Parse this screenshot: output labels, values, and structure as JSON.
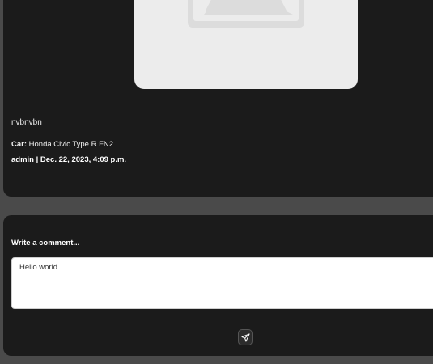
{
  "post": {
    "title": "nvbnvbn",
    "car_label": "Car:",
    "car_value": "Honda Civic Type R FN2",
    "meta": "admin | Dec. 22, 2023, 4:09 p.m.",
    "image_placeholder_icon": "image-placeholder-icon"
  },
  "comment_form": {
    "label": "Write a comment...",
    "input_value": "Hello world",
    "send_icon": "paper-plane-icon"
  },
  "colors": {
    "page_background": "#4a4a4a",
    "card_background": "#1b1b1b",
    "image_placeholder": "#ececec",
    "text": "#f0f0f0"
  }
}
